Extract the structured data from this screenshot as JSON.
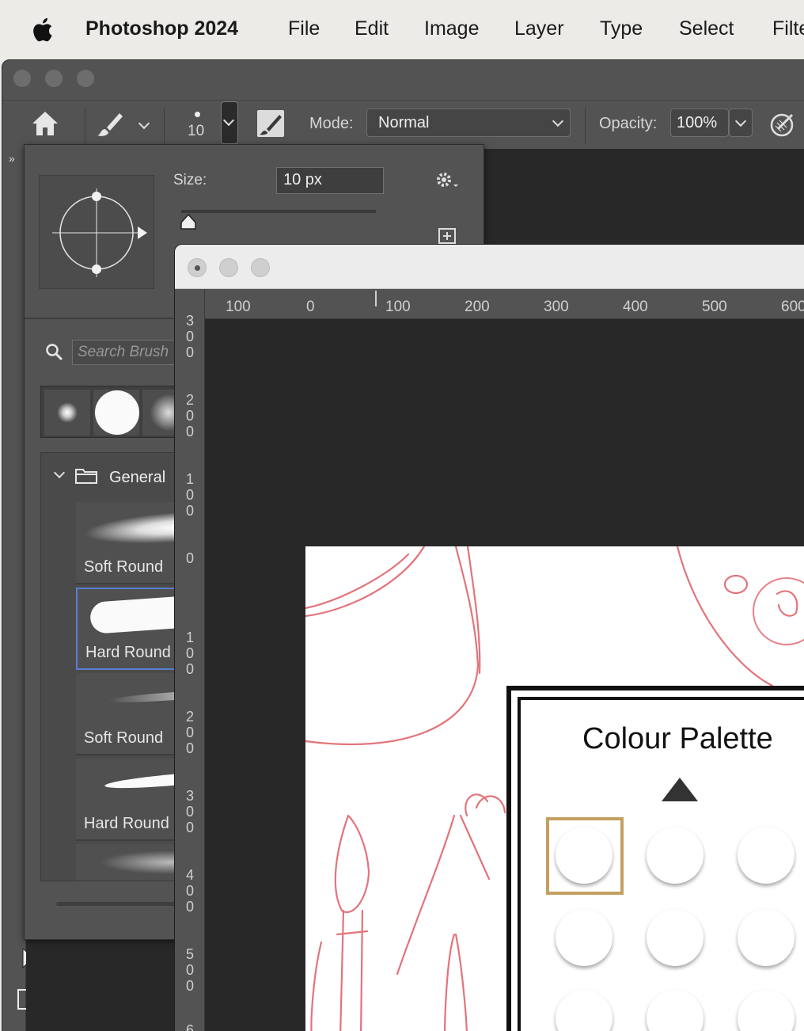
{
  "menu": {
    "app_name": "Photoshop 2024",
    "items": [
      "File",
      "Edit",
      "Image",
      "Layer",
      "Type",
      "Select",
      "Filter"
    ]
  },
  "options_bar": {
    "brush_size_value": "10",
    "mode_label": "Mode:",
    "mode_value": "Normal",
    "opacity_label": "Opacity:",
    "opacity_value": "100%"
  },
  "brush_popover": {
    "size_label": "Size:",
    "size_value": "10 px",
    "size_slider_fraction": 0.0,
    "search_placeholder": "Search Brush",
    "folder_name": "General",
    "brushes": [
      {
        "name": "Soft Round",
        "selected": false
      },
      {
        "name": "Hard Round",
        "selected": true
      },
      {
        "name": "Soft Round",
        "selected": false
      },
      {
        "name": "Hard Round",
        "selected": false
      }
    ]
  },
  "document": {
    "hruler_ticks": [
      "100",
      "0",
      "100",
      "200",
      "300",
      "400",
      "500",
      "600"
    ],
    "vruler_ticks": [
      "300",
      "200",
      "100",
      "0",
      "100",
      "200",
      "300",
      "400",
      "500",
      "6"
    ],
    "palette_title": "Colour Palette"
  },
  "colors": {
    "accent_selection": "#5a7ecf",
    "sketch_red": "#d9464f",
    "swatch_highlight": "#c4a060"
  }
}
